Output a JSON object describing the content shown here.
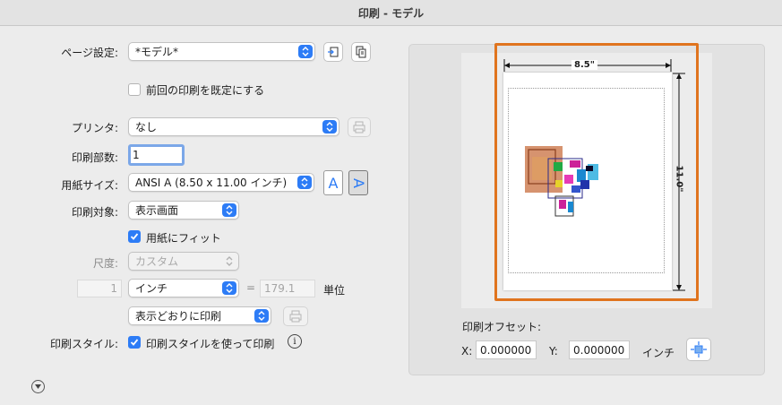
{
  "window": {
    "title": "印刷 - モデル"
  },
  "page_setup": {
    "label": "ページ設定:",
    "value": "*モデル*"
  },
  "save_default": {
    "label": "前回の印刷を既定にする",
    "checked": false
  },
  "printer": {
    "label": "プリンタ:",
    "value": "なし"
  },
  "copies": {
    "label": "印刷部数:",
    "value": "1"
  },
  "paper_size": {
    "label": "用紙サイズ:",
    "value": "ANSI A (8.50 x 11.00 インチ)"
  },
  "orientation": {
    "portrait_glyph": "A",
    "landscape_glyph": "A",
    "selected": "landscape"
  },
  "plot_area": {
    "label": "印刷対象:",
    "value": "表示画面"
  },
  "fit_to_paper": {
    "label": "用紙にフィット",
    "checked": true
  },
  "scale": {
    "label": "尺度:",
    "value": "カスタム",
    "left_value": "1",
    "units_value": "インチ",
    "equals": "=",
    "right_value": "179.1",
    "unit_label": "単位"
  },
  "shade_plot": {
    "value": "表示どおりに印刷"
  },
  "plot_style": {
    "label": "印刷スタイル:",
    "checkbox_label": "印刷スタイルを使って印刷",
    "checked": true,
    "info_glyph": "i"
  },
  "preview": {
    "width_label": "8.5\"",
    "height_label": "11.0\"",
    "offset_label": "印刷オフセット:",
    "x_label": "X:",
    "x_value": "0.000000",
    "y_label": "Y:",
    "y_value": "0.000000",
    "units": "インチ"
  },
  "colors": {
    "accent": "#2d7cf6",
    "highlight": "#e0741e"
  }
}
